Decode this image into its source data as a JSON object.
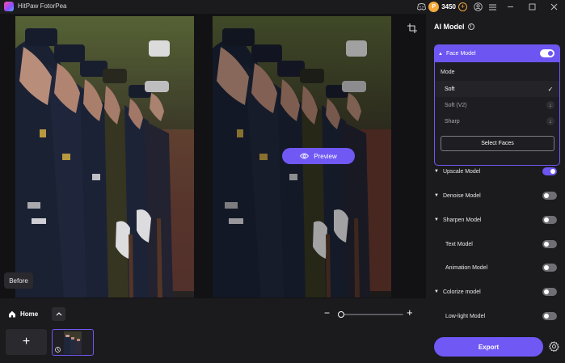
{
  "app": {
    "title": "HitPaw FotorPea",
    "coin_symbol": "P",
    "coins": "3450",
    "coin_add": "+"
  },
  "canvas": {
    "before_label": "Before",
    "preview_label": "Preview"
  },
  "bottom": {
    "home_label": "Home",
    "zoom_out": "−",
    "zoom_in": "+",
    "add_symbol": "+",
    "zoom_level": 0.0
  },
  "panel": {
    "title": "AI Model",
    "face_model": {
      "label": "Face Model",
      "enabled": true,
      "mode_label": "Mode",
      "modes": [
        {
          "label": "Soft",
          "selected": true
        },
        {
          "label": "Soft (V2)",
          "selected": false
        },
        {
          "label": "Sharp",
          "selected": false
        }
      ],
      "select_faces_label": "Select Faces"
    },
    "models": [
      {
        "label": "Upscale Model",
        "enabled": true,
        "expandable": true
      },
      {
        "label": "Denoise Model",
        "enabled": false,
        "expandable": true
      },
      {
        "label": "Sharpen Model",
        "enabled": false,
        "expandable": true
      },
      {
        "label": "Text Model",
        "enabled": false,
        "expandable": false
      },
      {
        "label": "Animation Model",
        "enabled": false,
        "expandable": false
      },
      {
        "label": "Colorize model",
        "enabled": false,
        "expandable": true
      },
      {
        "label": "Low-light Model",
        "enabled": false,
        "expandable": false
      }
    ],
    "export_label": "Export"
  },
  "colors": {
    "accent": "#7058f5",
    "panel_bg": "#1b1b1e",
    "coin": "#f3a93b"
  }
}
